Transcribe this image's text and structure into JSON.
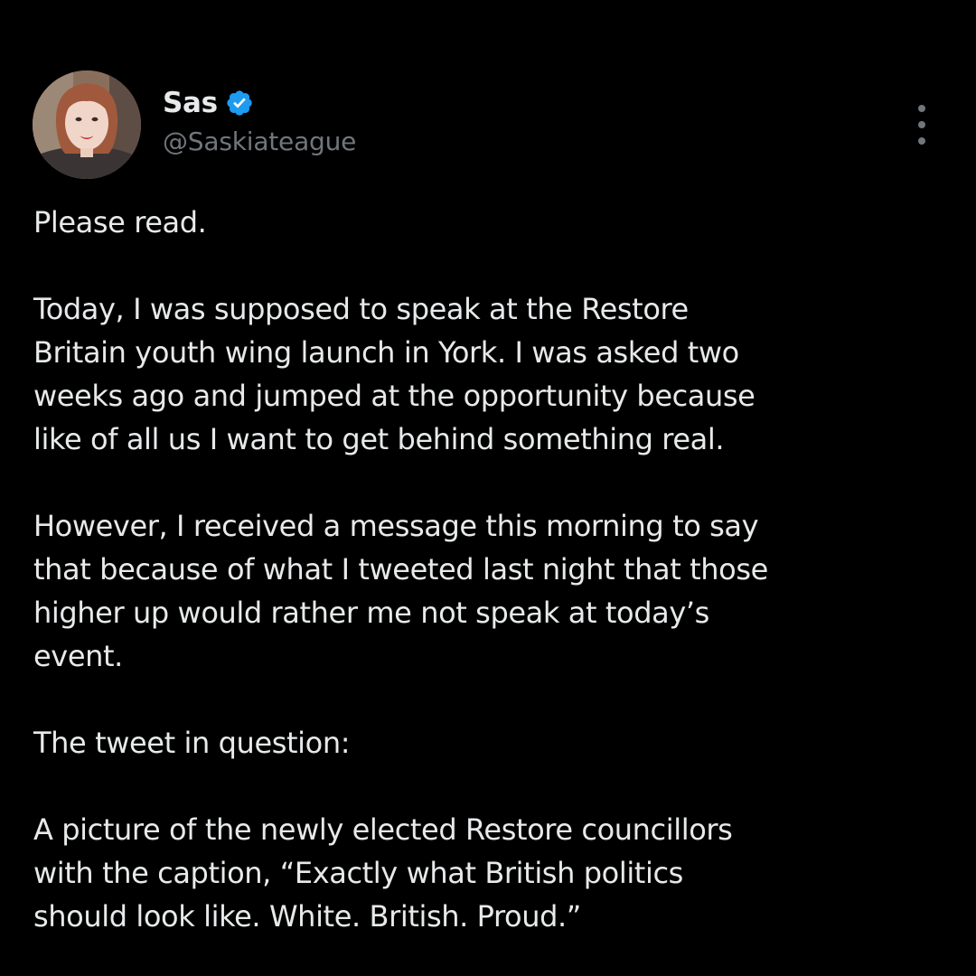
{
  "post": {
    "author": {
      "display_name": "Sas",
      "handle": "@Saskiateague",
      "verified": true,
      "verified_badge_color": "#1d9bf0",
      "avatar_icon": "profile-photo"
    },
    "more_menu_icon": "vertical-ellipsis-icon",
    "paragraphs": [
      "Please read.",
      "Today, I was supposed to speak at the Restore\nBritain youth wing launch in York. I was asked two\nweeks ago and jumped at the opportunity because\nlike of all us I want to get behind something real.",
      "However, I received a message this morning to say\nthat because of what I tweeted last night that those\nhigher up would rather me not speak at today’s\nevent.",
      "The tweet in question:",
      "A picture of the newly elected Restore councillors\nwith the caption, “Exactly what British politics\nshould look like. White. British. Proud.”"
    ]
  },
  "colors": {
    "background": "#000000",
    "text_primary": "#e7e9ea",
    "text_secondary": "#71767b",
    "accent_blue": "#1d9bf0"
  }
}
